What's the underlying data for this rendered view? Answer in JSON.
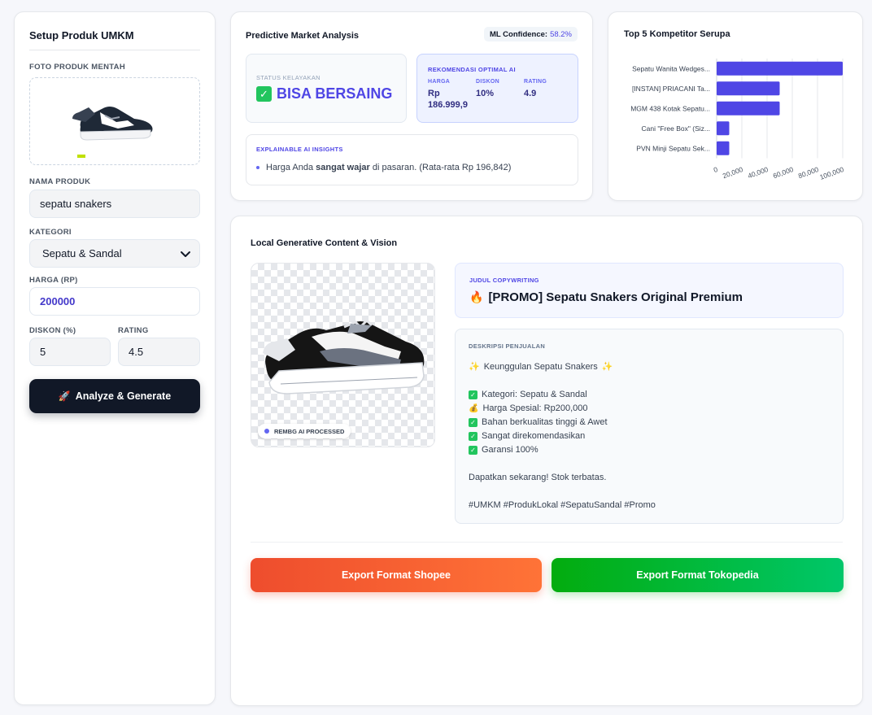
{
  "setup": {
    "title": "Setup Produk UMKM",
    "photo_label": "FOTO PRODUK MENTAH",
    "name_label": "NAMA PRODUK",
    "name_value": "sepatu snakers",
    "category_label": "KATEGORI",
    "category_value": "Sepatu & Sandal",
    "price_label": "HARGA (RP)",
    "price_value": "200000",
    "discount_label": "DISKON (%)",
    "discount_value": "5",
    "rating_label": "RATING",
    "rating_value": "4.5",
    "analyze_label": "Analyze & Generate",
    "analyze_icon": "rocket-icon"
  },
  "market": {
    "title": "Predictive Market Analysis",
    "confidence_label": "ML Confidence:",
    "confidence_value": "58.2%",
    "status_label": "STATUS KELAYAKAN",
    "status_value": "BISA BERSAING",
    "reco_label": "REKOMENDASI OPTIMAL AI",
    "reco_price_label": "HARGA",
    "reco_price_value": "Rp 186.999,9",
    "reco_discount_label": "DISKON",
    "reco_discount_value": "10%",
    "reco_rating_label": "RATING",
    "reco_rating_value": "4.9",
    "insights_label": "EXPLAINABLE AI INSIGHTS",
    "insight_pre": "Harga Anda ",
    "insight_bold": "sangat wajar",
    "insight_post": " di pasaran. (Rata-rata Rp 196,842)",
    "accent": "#4f46e5",
    "status_color": "#22c55e"
  },
  "competitors": {
    "title": "Top 5 Kompetitor Serupa",
    "chart_data": {
      "type": "bar",
      "orientation": "horizontal",
      "categories": [
        "Sepatu Wanita Wedges...",
        "[INSTAN] PRIACANI Ta...",
        "MGM 438 Kotak Sepatu...",
        "Cani \"Free Box\" (Siz...",
        "PVN Minji Sepatu Sek..."
      ],
      "values": [
        100000,
        50000,
        50000,
        10000,
        10000
      ],
      "xlim": [
        0,
        100000
      ],
      "xticks": [
        "0",
        "20,000",
        "40,000",
        "60,000",
        "80,000",
        "100,000"
      ],
      "grid": true,
      "color": "#4f46e5"
    }
  },
  "generative": {
    "title": "Local Generative Content & Vision",
    "rembg_label": "REMBG AI PROCESSED",
    "copy_label": "JUDUL COPYWRITING",
    "copy_title": "[PROMO] Sepatu Snakers Original Premium",
    "desc_label": "DESKRIPSI PENJUALAN",
    "desc_headline": "Keunggulan Sepatu Snakers",
    "desc_bullets": [
      "Kategori: Sepatu & Sandal",
      "Harga Spesial: Rp200,000",
      "Bahan berkualitas tinggi & Awet",
      "Sangat direkomendasikan",
      "Garansi 100%"
    ],
    "desc_cta": "Dapatkan sekarang! Stok terbatas.",
    "desc_tags": "#UMKM #ProdukLokal #SepatuSandal #Promo",
    "export_shopee": "Export Format Shopee",
    "export_tokopedia": "Export Format Tokopedia",
    "shopee_color": "#ee4d2d",
    "tokopedia_color": "#03ac0e"
  }
}
